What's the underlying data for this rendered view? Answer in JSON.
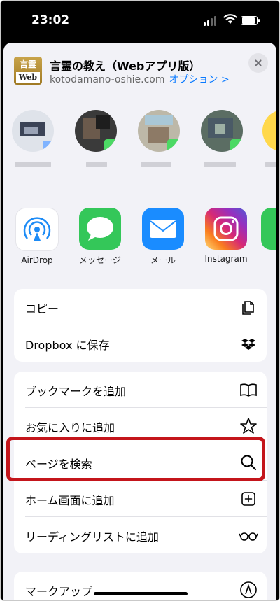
{
  "status_bar": {
    "time": "23:02"
  },
  "share_header": {
    "app_icon_text_top": "言霊",
    "app_icon_text_bottom": "Web",
    "title": "言霊の教え（Webアプリ版）",
    "domain": "kotodamano-oshie.com",
    "options_label": "オプション >"
  },
  "apps": [
    {
      "label": "AirDrop",
      "icon": "airdrop-icon",
      "color": "#1c8bf6"
    },
    {
      "label": "メッセージ",
      "icon": "messages-icon",
      "color": "#34c759"
    },
    {
      "label": "メール",
      "icon": "mail-icon",
      "color": "#1a8cff"
    },
    {
      "label": "Instagram",
      "icon": "instagram-icon",
      "color": "#d62976"
    }
  ],
  "actions_group1": [
    {
      "label": "コピー",
      "icon": "copy-icon"
    },
    {
      "label": "Dropbox に保存",
      "icon": "dropbox-icon"
    }
  ],
  "actions_group2": [
    {
      "label": "ブックマークを追加",
      "icon": "book-icon"
    },
    {
      "label": "お気に入りに追加",
      "icon": "star-icon"
    },
    {
      "label": "ページを検索",
      "icon": "search-icon"
    },
    {
      "label": "ホーム画面に追加",
      "icon": "add-square-icon"
    },
    {
      "label": "リーディングリストに追加",
      "icon": "glasses-icon"
    }
  ],
  "actions_group3": [
    {
      "label": "マークアップ",
      "icon": "markup-icon"
    }
  ],
  "highlight_color": "#c4151b"
}
